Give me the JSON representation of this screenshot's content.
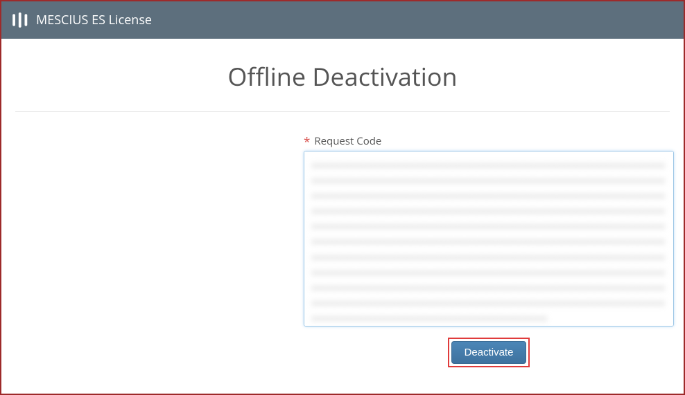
{
  "header": {
    "title": "MESCIUS ES License"
  },
  "page": {
    "title": "Offline Deactivation"
  },
  "form": {
    "request_code_label": "Request Code",
    "request_code_value": "xxxxxxxxxxxxxxxxxxxxxxxxxxxxxxxxxxxxxxxxxxxxxxxxxxxxxxxxxxxxxxxxxxxxxxxxxxxxxxxxxxxxxxxxxxxxxxxxxxxxxxxxxxxxxxxxxxxxxxxxxxxxxxxxxxxxxxxxxxxxxxxxxxxxxxxxxxxxxxxxxxxxxxxxxxxxxxxxxxxxxxxxxxxxxxxxxxxxxxxxxxxxxxxxxxxxxxxxxxxxxxxxxxxxxxxxxxxxxxxxxxxxxxxxxxxxxxxxxxxxxxxxxxxxxxxxxxxxxxxxxxxxxxxxxxxxxxxxxxxxxxxxxxxxxxxxxxxxxxxxxxxxxxxxxxxxxxxxxxxxxxxxxxxxxxxxxxxxxxxxxxxxxxxxxxxxxxxxxxxxxxxxxxxxxxxxxxxxxxxxxxxxxxxxxxxxxxxxxxxxxxxxxxxxxxxxxxxxxxxxxxxxxxxxxxxxxxxxxxxxxxxxxxxxxxxxxxxxxxxxxxxxxxxxxxxxxxxxxxxxxxxxxxxxxxxxxxxxxxxxxxxxxxxxxxxxxxxxxxxxxxxxxxxxxxxxxxxxxxxxxxxxxxxxxxxxxxxxxxxxxxxxxxxxxxxxxxxxxxxxxxxxxxxxxxxxxxxxxxxxxxxxxxxxxxxxxxxxxxxxxxxxxxxxxxxxxxxxxxxxxxxxxxxxxxxxxxxxxxxxxxxxxxxxxxxxxxxxxxxxxxxxxxxxxxxxxxxxxxxxxxxxxxxxxxxxxxxxxxxxxxxxxxxxxxxxxxxxxxxxxxxxxxxxxxxxxxxxxxxxxxxxxxxxxxxxxxxxxxxx"
  },
  "buttons": {
    "deactivate_label": "Deactivate"
  },
  "colors": {
    "header_bg": "#5d6f7d",
    "accent_border": "#9d2a2a",
    "button_bg": "#447ba8",
    "highlight_border": "#e03b3b"
  }
}
